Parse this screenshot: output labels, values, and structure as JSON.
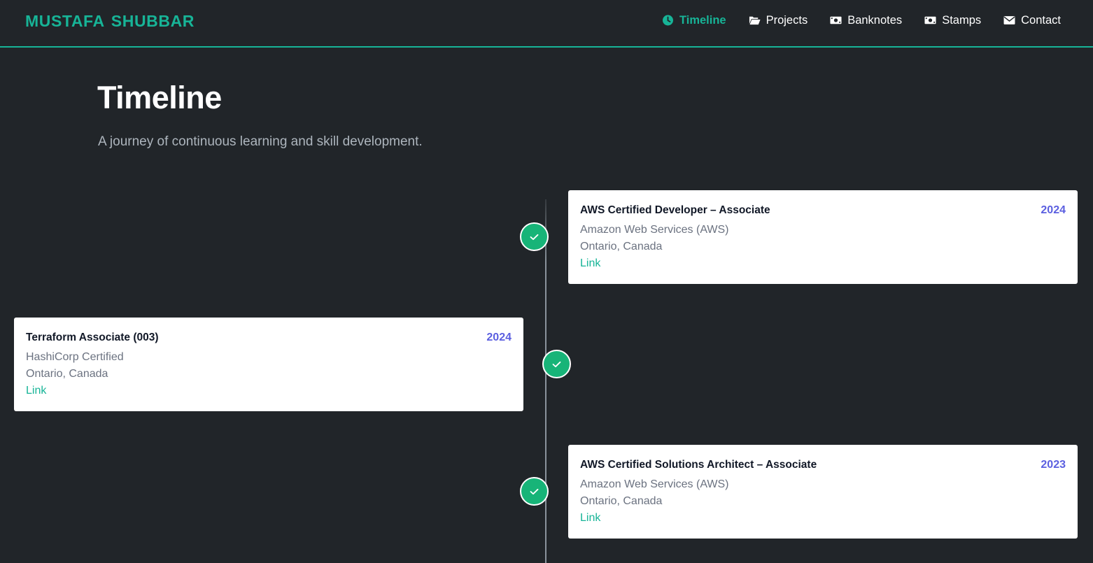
{
  "brand": "MUSTAFA SHUBBAR",
  "nav": [
    {
      "label": "Timeline",
      "icon": "clock-icon",
      "active": true
    },
    {
      "label": "Projects",
      "icon": "folder-open-icon",
      "active": false
    },
    {
      "label": "Banknotes",
      "icon": "banknote-icon",
      "active": false
    },
    {
      "label": "Stamps",
      "icon": "stamp-icon",
      "active": false
    },
    {
      "label": "Contact",
      "icon": "envelope-icon",
      "active": false
    }
  ],
  "page": {
    "title": "Timeline",
    "subtitle": "A journey of continuous learning and skill development."
  },
  "timeline": [
    {
      "title": "AWS Certified Developer – Associate",
      "year": "2024",
      "organization": "Amazon Web Services (AWS)",
      "location": "Ontario, Canada",
      "link_label": "Link"
    },
    {
      "title": "Terraform Associate (003)",
      "year": "2024",
      "organization": "HashiCorp Certified",
      "location": "Ontario, Canada",
      "link_label": "Link"
    },
    {
      "title": "AWS Certified Solutions Architect – Associate",
      "year": "2023",
      "organization": "Amazon Web Services (AWS)",
      "location": "Ontario, Canada",
      "link_label": "Link"
    }
  ],
  "colors": {
    "background": "#212529",
    "accent": "#17b497",
    "marker": "#17b478",
    "year": "#5b5fe0"
  }
}
